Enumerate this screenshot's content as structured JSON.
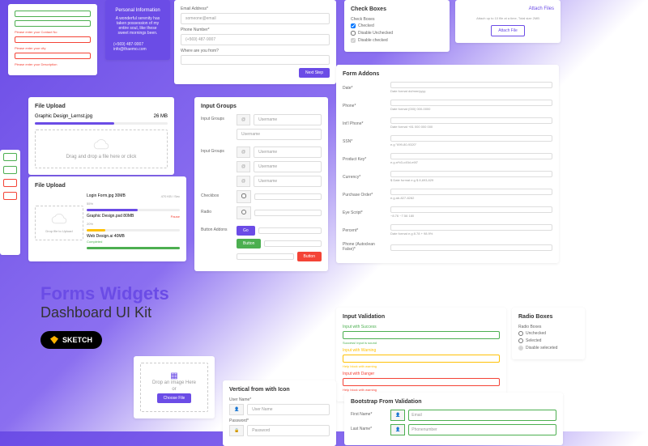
{
  "title": {
    "line1": "Forms Widgets",
    "line2": "Dashboard UI Kit",
    "badge": "SKETCH"
  },
  "errors": {
    "e1": "Please enter your Contact No",
    "e2": "Please enter your city",
    "e3": "Please enter your Description"
  },
  "purple": {
    "heading": "Personal Information",
    "desc": "A wonderful serenity has taken possession of my entire soul, like these sweet mornings been.",
    "phone": "(+569) 487-9007",
    "email": "info@thaemo.com"
  },
  "form1": {
    "email_label": "Email Address*",
    "email_ph": "someone@email",
    "phone_label": "Phone Number*",
    "phone_ph": "(+569) 487-9007",
    "where_label": "Where are you from?",
    "next": "Next Step"
  },
  "fileupload1": {
    "title": "File Upload",
    "file": "Graphic Design_Lernst.jpg",
    "size": "26 MB",
    "dz": "Drag and drop a file here or click"
  },
  "fileupload2": {
    "title": "File Upload",
    "dz": "Drop file to Upload",
    "f1": "Login Form.jpg 30MB",
    "p1": "55%",
    "meta1": "470 KB / Sec",
    "f2": "Graphic Design.psd 80MB",
    "p2": "20%",
    "status2": "Pause",
    "f3": "Web Design.ai 40MB",
    "p3": "Completed"
  },
  "checkboxes": {
    "title": "Check Boxes",
    "label": "Check Boxes",
    "c1": "Checked",
    "c2": "Disable Unchecked",
    "c3": "Disable checked"
  },
  "attach": {
    "link": "Attach Files",
    "hint": "Attach up to 10 file at a time, Total size 2MB",
    "btn": "Attach File"
  },
  "inputgroups": {
    "title": "Input Groups",
    "l1": "Input Groups",
    "ph": "Username",
    "l2": "Input Groups",
    "l3": "Checkbox",
    "l4": "Radio",
    "l5": "Button Addons",
    "go": "Go",
    "btn_g": "Button",
    "btn_r": "Button"
  },
  "addons": {
    "title": "Form Addons",
    "date": "Date*",
    "date_hint": "Date format dd/mm/yyyy",
    "phone": "Phone*",
    "phone_hint": "Date format (000) 000-0000",
    "intl": "Int'l Phone*",
    "intl_hint": "Date format +81 000 000 000",
    "ssn": "SSN*",
    "ssn_hint": "e.g \"699-80-9320\"",
    "pkey": "Product Key*",
    "pkey_hint": "e.g a*b3-c45d-e6f7",
    "curr": "Currency*",
    "curr_hint": "$ Date format e.g $ 8,693,829",
    "po": "Purchase Order*",
    "po_hint": "e.g ab-827-8282",
    "eye": "Eye Script*",
    "eye_hint": "~8.76 ~7.56 180",
    "pct": "Percent*",
    "pct_hint": "Date format e.g 8.78 + 98.9%",
    "pac": "Phone (Autoclean False)*"
  },
  "validation": {
    "title": "Input Validation",
    "l1": "Input with Success",
    "h1": "Success! input is sound",
    "l2": "Input with Warning",
    "h2": "Help block with warning",
    "l3": "Input with Danger",
    "h3": "Help block with warning"
  },
  "radio": {
    "title": "Radio Boxes",
    "label": "Radio Boxes",
    "r1": "Unchecked",
    "r2": "Selected",
    "r3": "Disable seleceted"
  },
  "imgdrop": {
    "txt": "Drop an image Here",
    "or": "or",
    "btn": "Choose File"
  },
  "vertical": {
    "title": "Vertical from with Icon",
    "l1": "User Name*",
    "ph1": "User Name",
    "l2": "Password*",
    "ph2": "Password"
  },
  "bootstrap": {
    "title": "Bootstrap From Validation",
    "l1": "First Name*",
    "ph1": "Email",
    "l2": "Last Name*",
    "ph2": "Phonenumber"
  }
}
